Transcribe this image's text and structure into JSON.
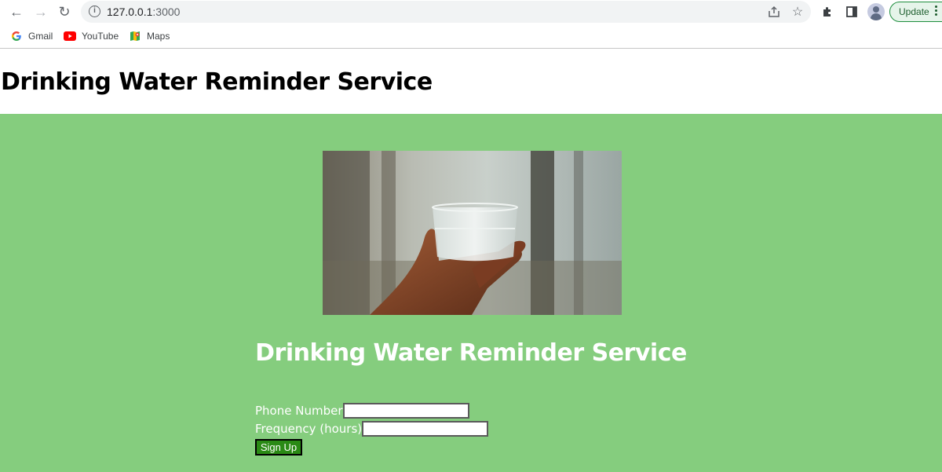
{
  "browser": {
    "url_host": "127.0.0.1",
    "url_port": ":3000",
    "update_label": "Update",
    "bookmarks": [
      {
        "label": "Gmail",
        "icon": "google-icon"
      },
      {
        "label": "YouTube",
        "icon": "youtube-icon"
      },
      {
        "label": "Maps",
        "icon": "maps-icon"
      }
    ]
  },
  "header": {
    "title": "Drinking Water Reminder Service"
  },
  "main": {
    "hero_image_alt": "hand holding glass of water",
    "heading": "Drinking Water Reminder Service",
    "form": {
      "phone_label": "Phone Number",
      "phone_value": "",
      "frequency_label": "Frequency (hours)",
      "frequency_value": "",
      "submit_label": "Sign Up"
    }
  },
  "colors": {
    "panel_bg": "#85cd7e",
    "button_bg": "#2a8a15",
    "update_border": "#1e8e3e"
  }
}
